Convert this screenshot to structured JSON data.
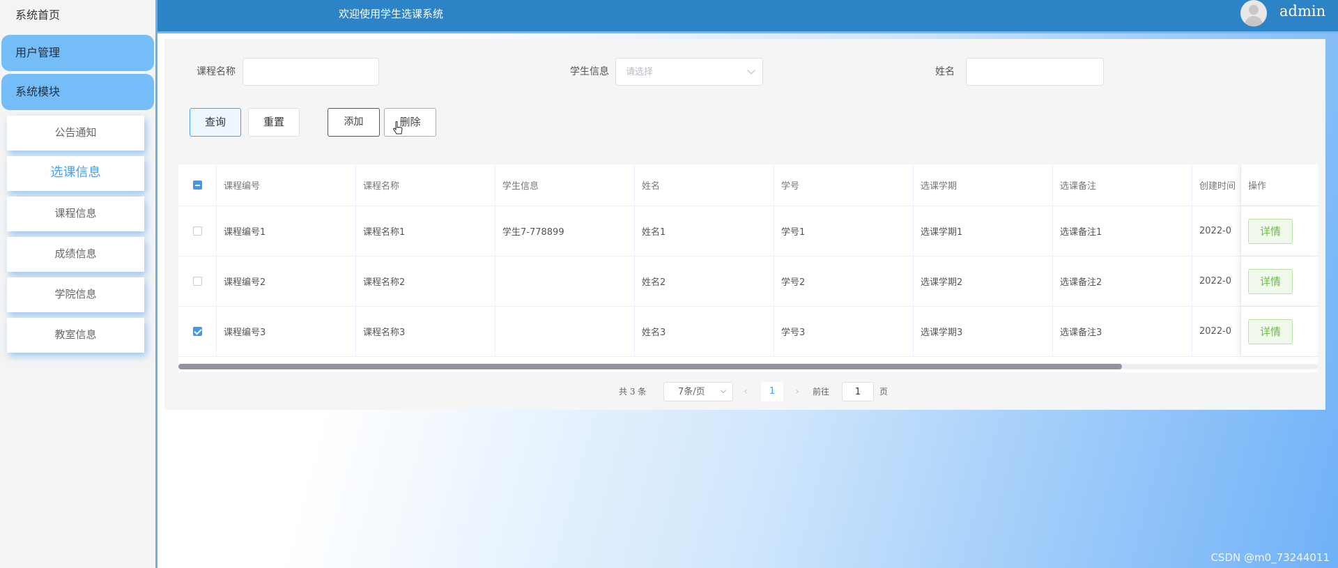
{
  "sidebar": {
    "home": "系统首页",
    "menus": [
      "用户管理",
      "系统模块"
    ],
    "subs": [
      "公告通知",
      "选课信息",
      "课程信息",
      "成绩信息",
      "学院信息",
      "教室信息"
    ]
  },
  "header": {
    "title": "欢迎使用学生选课系统",
    "username": "admin"
  },
  "filters": {
    "course_name_label": "课程名称",
    "course_name_value": "",
    "student_info_label": "学生信息",
    "student_info_placeholder": "请选择",
    "name_label": "姓名",
    "name_value": ""
  },
  "buttons": {
    "query": "查询",
    "reset": "重置",
    "add": "添加",
    "delete": "删除",
    "detail": "详情"
  },
  "table": {
    "columns": [
      "课程编号",
      "课程名称",
      "学生信息",
      "姓名",
      "学号",
      "选课学期",
      "选课备注",
      "创建时间",
      "操作"
    ],
    "rows": [
      {
        "checked": false,
        "cells": [
          "课程编号1",
          "课程名称1",
          "学生7-778899",
          "姓名1",
          "学号1",
          "选课学期1",
          "选课备注1",
          "2022-0"
        ]
      },
      {
        "checked": false,
        "cells": [
          "课程编号2",
          "课程名称2",
          "",
          "姓名2",
          "学号2",
          "选课学期2",
          "选课备注2",
          "2022-0"
        ]
      },
      {
        "checked": true,
        "cells": [
          "课程编号3",
          "课程名称3",
          "",
          "姓名3",
          "学号3",
          "选课学期3",
          "选课备注3",
          "2022-0"
        ]
      }
    ]
  },
  "pagination": {
    "total": "共 3 条",
    "page_size": "7条/页",
    "prev": "‹",
    "next": "›",
    "current": "1",
    "goto_label": "前往",
    "goto_value": "1",
    "page_label": "页"
  },
  "watermark": "CSDN @m0_73244011",
  "colors": {
    "header": "#2c84c7",
    "menu": "#74bdf8",
    "accent": "#409eff",
    "success": "#67c23a"
  }
}
